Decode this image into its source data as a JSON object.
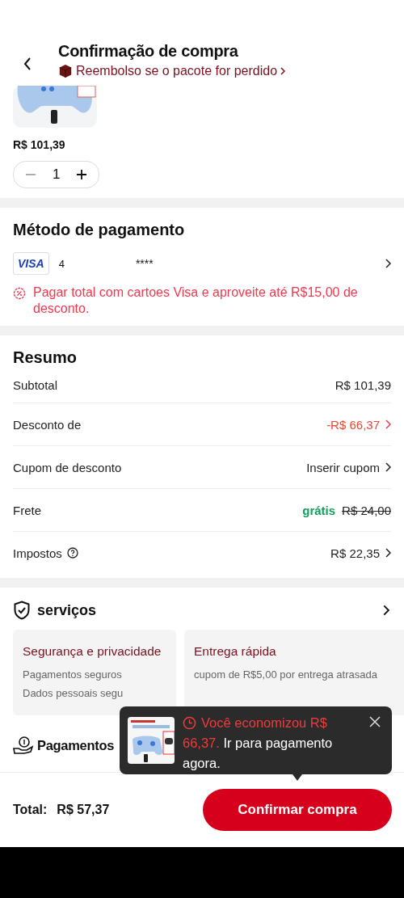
{
  "header": {
    "title": "Confirmação de compra",
    "notice": "Reembolso se o pacote for perdido"
  },
  "product": {
    "price": "R$ 101,39",
    "quantity": "1"
  },
  "payment": {
    "title": "Método de pagamento",
    "brand": "VISA",
    "card_start": "4",
    "card_mask": "****",
    "promo": "Pagar total  com cartoes Visa e aproveite até R$15,00 de desconto."
  },
  "summary": {
    "title": "Resumo",
    "rows": [
      {
        "kind": "plain",
        "label": "Subtotal",
        "value": "R$ 101,39"
      },
      {
        "kind": "discount",
        "label": "Desconto de",
        "value": "-R$ 66,37"
      },
      {
        "kind": "link",
        "label": "Cupom de desconto",
        "value": "Inserir cupom"
      },
      {
        "kind": "shipping",
        "label": "Frete",
        "free": "grátis",
        "value": "R$ 24,00"
      },
      {
        "kind": "tax",
        "label": "Impostos",
        "value": "R$ 22,35"
      }
    ]
  },
  "services": {
    "title": "serviços",
    "cards": [
      {
        "title": "Segurança e privacidade",
        "lines": [
          "Pagamentos seguros",
          "Dados pessoais segu"
        ]
      },
      {
        "title": "Entrega rápida",
        "lines": [
          "cupom de R$5,00 por entrega atrasada"
        ]
      }
    ]
  },
  "payments_heading": "Pagamentos",
  "footer": {
    "total_label": "Total:",
    "total": "R$ 57,37",
    "button": "Confirmar compra"
  },
  "toast": {
    "highlight_1": "Você economizou R$",
    "highlight_2": "66,37.",
    "text": " Ir para pagamento agora."
  }
}
